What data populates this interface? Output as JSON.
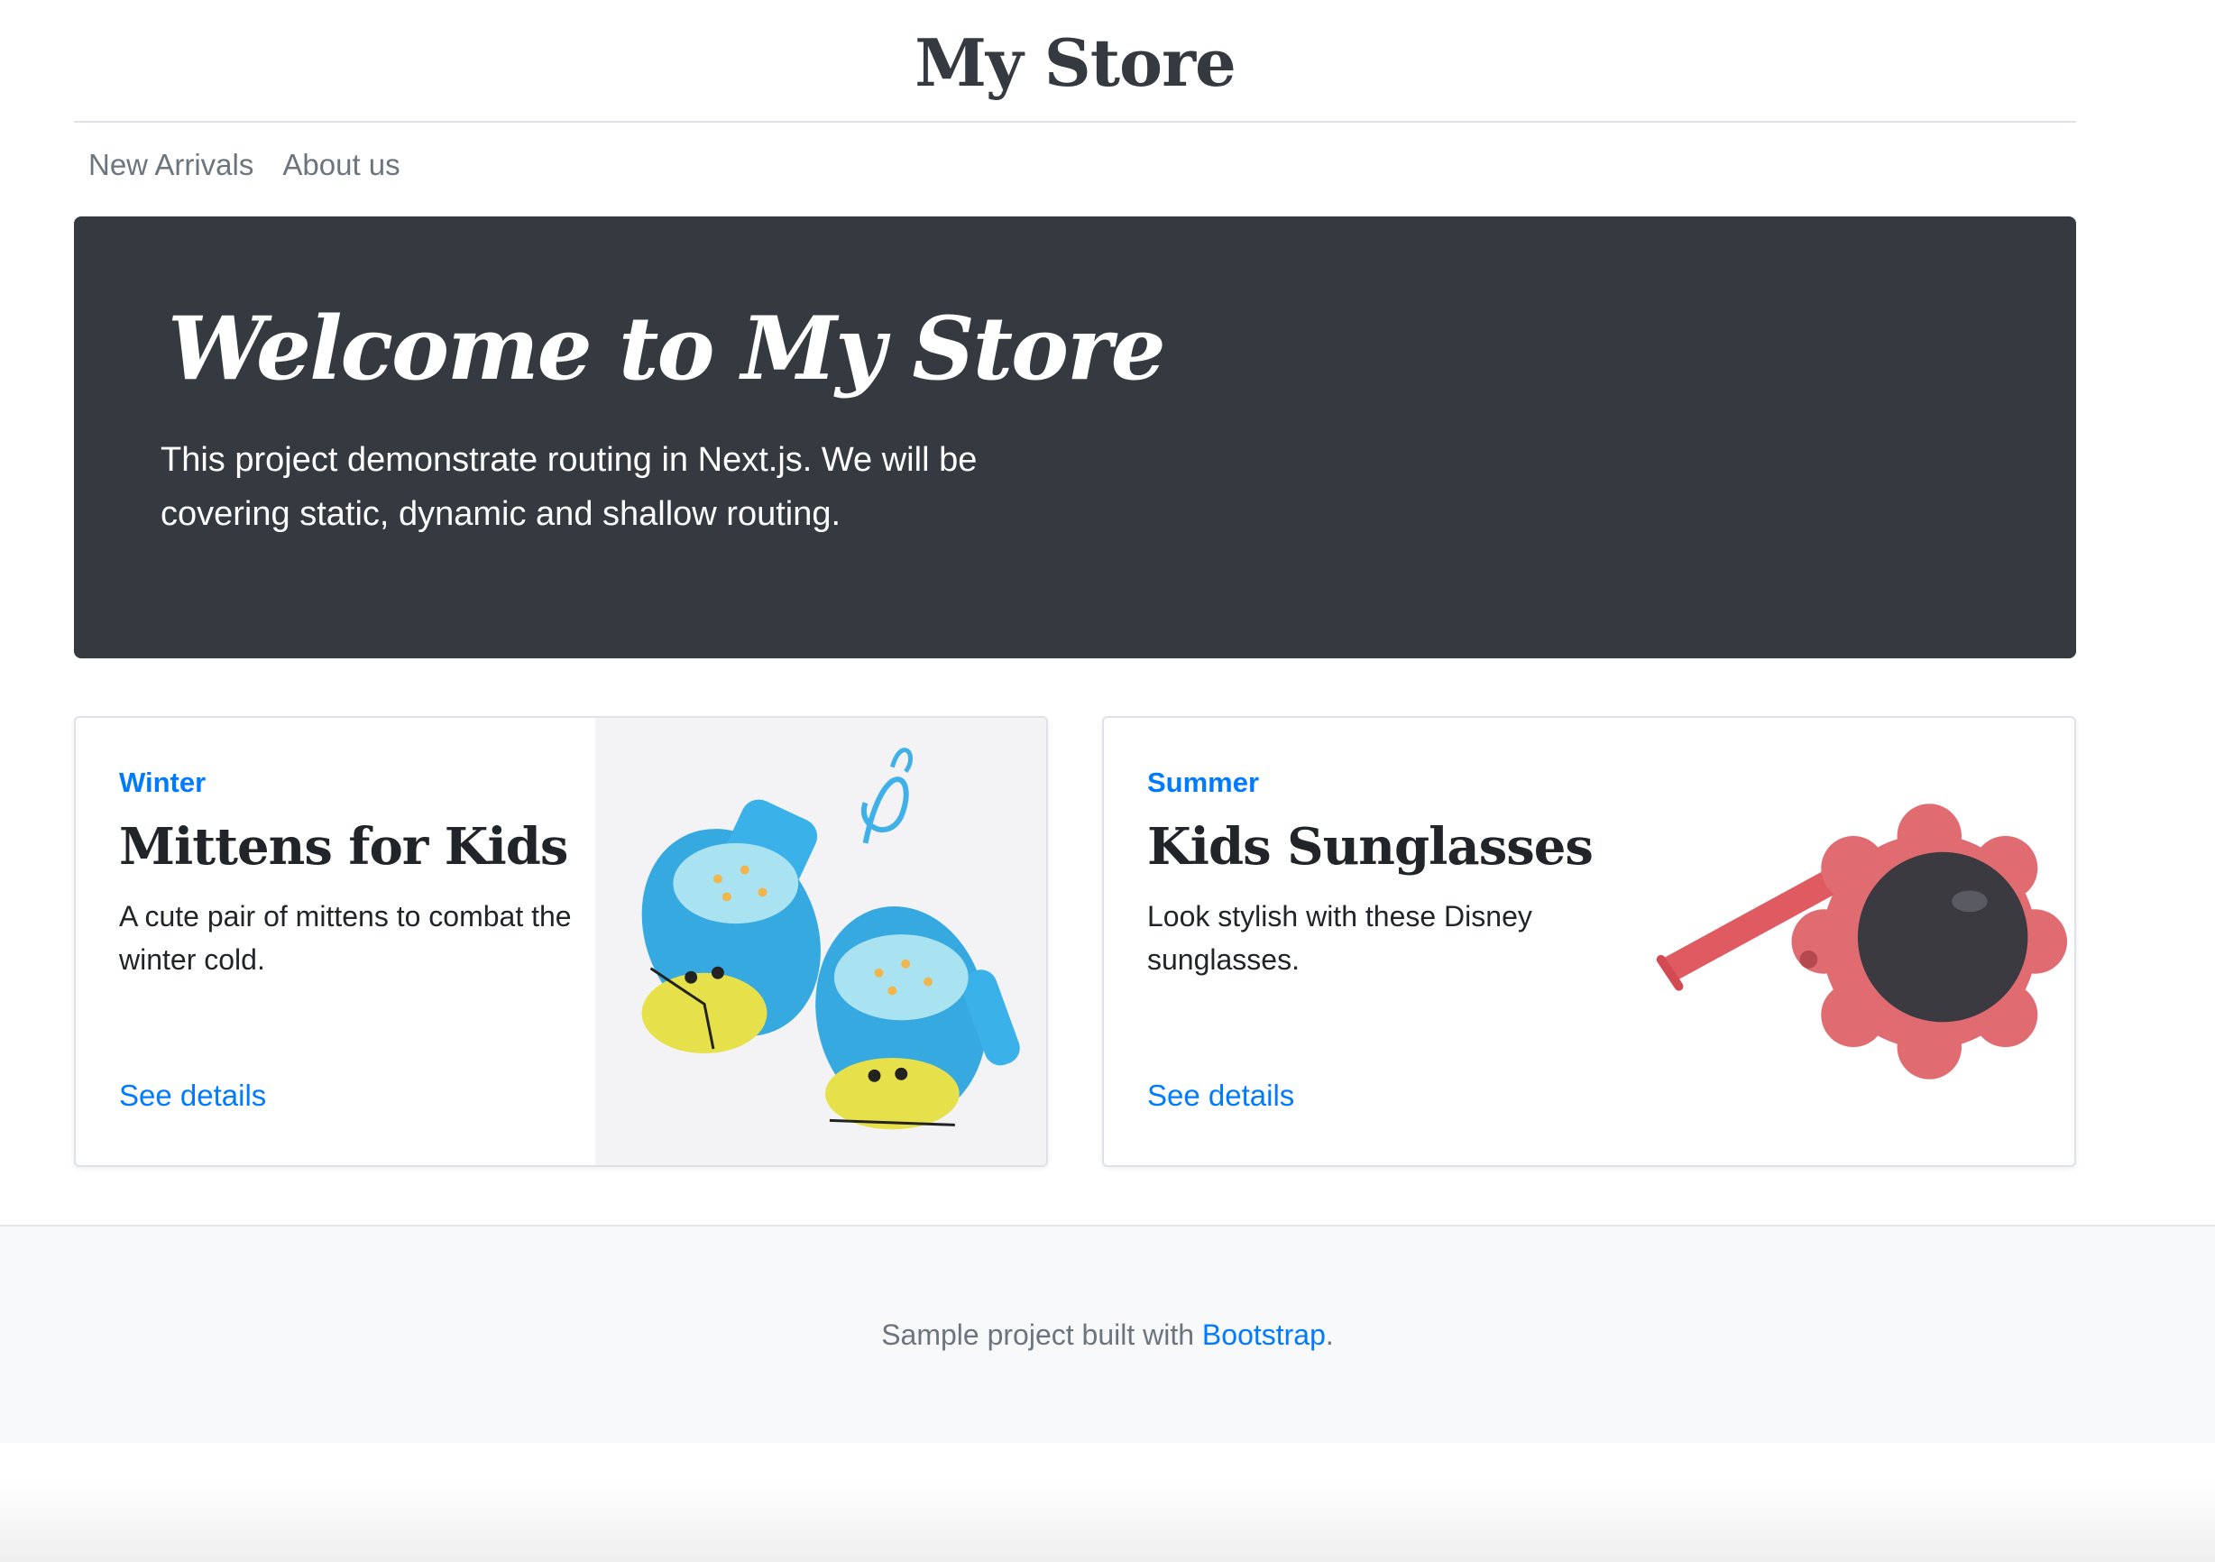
{
  "header": {
    "brand": "My Store"
  },
  "nav": {
    "items": [
      {
        "label": "New Arrivals"
      },
      {
        "label": "About us"
      }
    ]
  },
  "jumbotron": {
    "title": "Welcome to My Store",
    "lead": "This project demonstrate routing in Next.js. We will be covering static, dynamic and shallow routing."
  },
  "cards": [
    {
      "category": "Winter",
      "title": "Mittens for Kids",
      "text": "A cute pair of mittens to combat the winter cold.",
      "link": "See details",
      "image": "mittens-image"
    },
    {
      "category": "Summer",
      "title": "Kids Sunglasses",
      "text": "Look stylish with these Disney sunglasses.",
      "link": "See details",
      "image": "sunglasses-image"
    }
  ],
  "footer": {
    "text_before": "Sample project built with",
    "link": "Bootstrap",
    "text_after": "."
  },
  "colors": {
    "primary": "#007bff",
    "dark": "#343a40",
    "muted": "#6c757d",
    "footer_bg": "#f8f9fa"
  }
}
